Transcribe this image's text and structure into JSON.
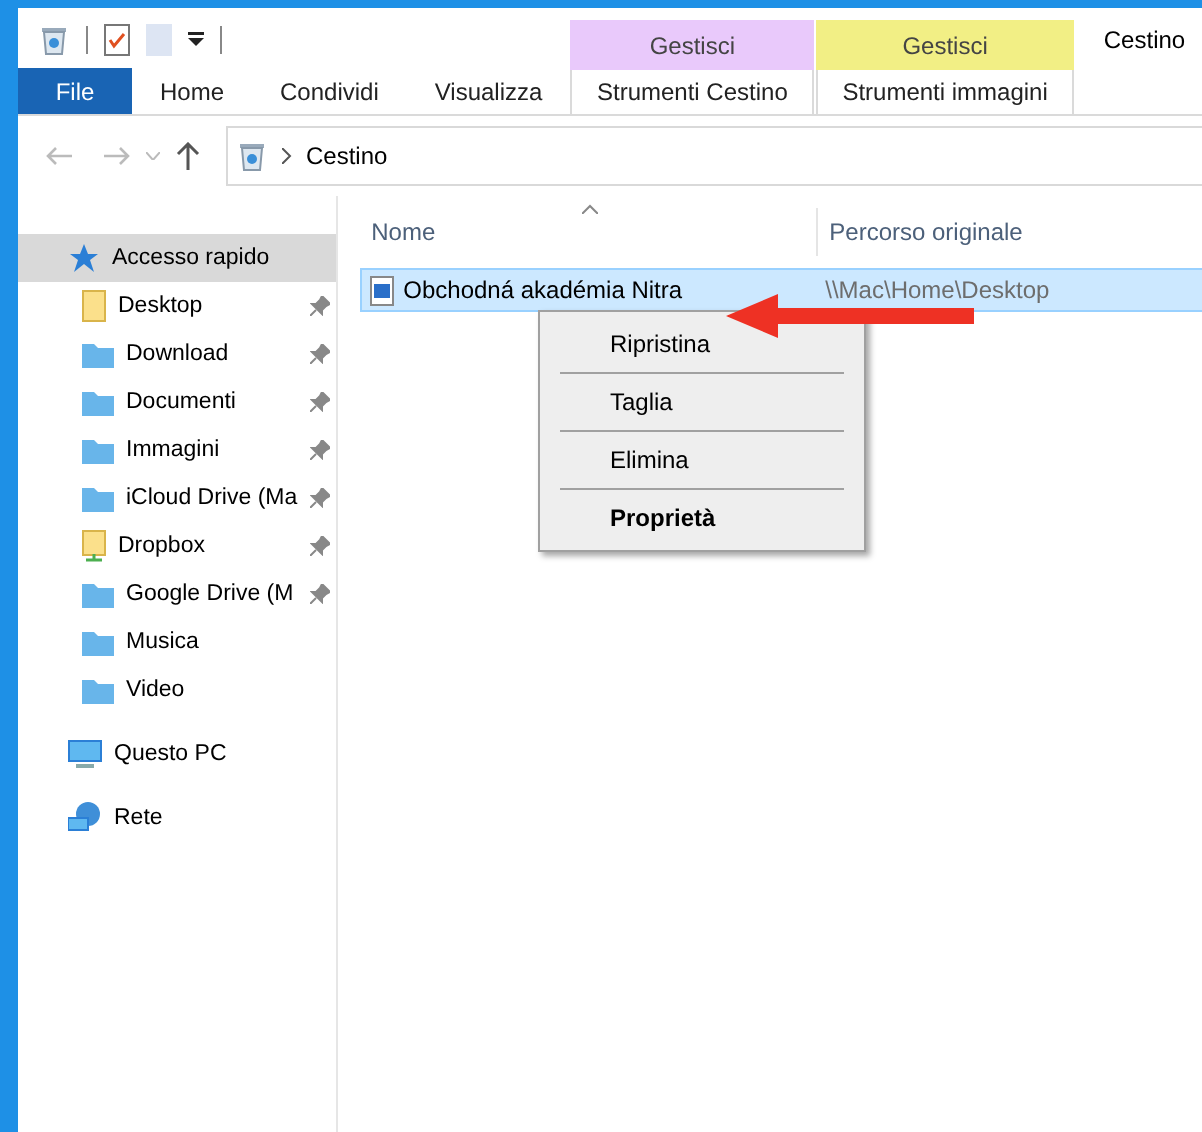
{
  "window": {
    "title": "Cestino"
  },
  "tabs": [
    {
      "label": "File",
      "kind": "file"
    },
    {
      "label": "Home",
      "kind": "plain"
    },
    {
      "label": "Condividi",
      "kind": "plain"
    },
    {
      "label": "Visualizza",
      "kind": "plain"
    }
  ],
  "context_tabs": [
    {
      "header": "Gestisci",
      "label": "Strumenti Cestino",
      "color": "#e9c9fb"
    },
    {
      "header": "Gestisci",
      "label": "Strumenti immagini",
      "color": "#f2ef85"
    }
  ],
  "address_bar": {
    "path": "Cestino"
  },
  "navigation": [
    {
      "label": "Accesso rapido",
      "kind": "star",
      "selected": true,
      "children": [
        {
          "label": "Desktop",
          "kind": "desktop",
          "pinned": true,
          "selected": false
        },
        {
          "label": "Download",
          "kind": "download",
          "pinned": true,
          "selected": false
        },
        {
          "label": "Documenti",
          "kind": "documents",
          "pinned": true,
          "selected": false
        },
        {
          "label": "Immagini",
          "kind": "pictures",
          "pinned": true,
          "selected": false
        },
        {
          "label": "iCloud Drive (Ma",
          "kind": "cloud",
          "pinned": true,
          "selected": false
        },
        {
          "label": "Dropbox",
          "kind": "dropbox",
          "pinned": true,
          "selected": false
        },
        {
          "label": "Google Drive (M",
          "kind": "drive",
          "pinned": true,
          "selected": false
        },
        {
          "label": "Musica",
          "kind": "music",
          "pinned": false,
          "selected": false
        },
        {
          "label": "Video",
          "kind": "video",
          "pinned": false,
          "selected": false
        }
      ]
    },
    {
      "label": "Questo PC",
      "kind": "pc",
      "selected": false
    },
    {
      "label": "Rete",
      "kind": "network",
      "selected": false
    }
  ],
  "table": {
    "columns": [
      "Nome",
      "Percorso originale"
    ],
    "rows": [
      {
        "name": "Obchodná akadémia Nitra",
        "path": "\\\\Mac\\Home\\Desktop",
        "selected": true
      }
    ]
  },
  "context_menu": {
    "items": [
      {
        "label": "Ripristina",
        "bold": false
      },
      {
        "label": "Taglia",
        "bold": false
      },
      {
        "label": "Elimina",
        "bold": false
      },
      {
        "label": "Proprietà",
        "bold": true
      }
    ]
  }
}
